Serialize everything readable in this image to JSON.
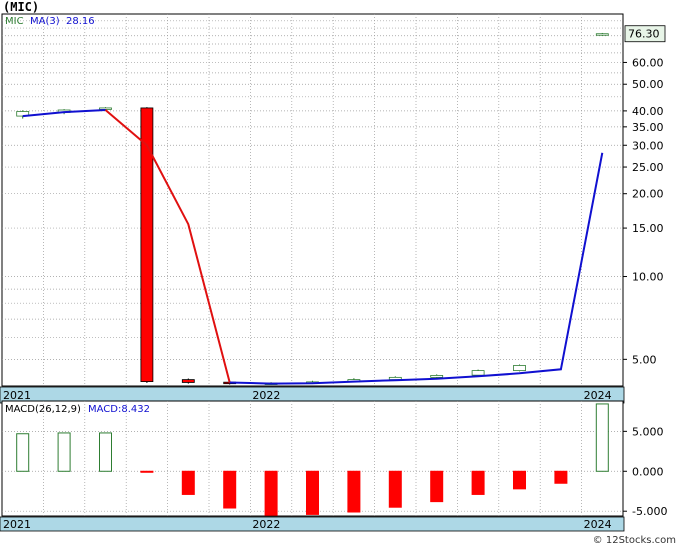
{
  "title": "(MIC)",
  "footer": "© 12Stocks.com",
  "colors": {
    "ma_line": "#1010d0",
    "decline_line": "#e01010",
    "bar_up": "#2e7d32",
    "bar_down": "#ff0000",
    "axis_band": "#add8e6",
    "grid": "#999999",
    "last_price_box": "#e8f5e8"
  },
  "chart_data": [
    {
      "type": "candlestick",
      "legend": {
        "ticker": "MIC",
        "ma_label": "MA(3)",
        "ma_value": "28.16"
      },
      "y_scale": "log",
      "ylim": [
        4.0,
        90.0
      ],
      "y_ticks": [
        {
          "value": 5,
          "label": "5.00"
        },
        {
          "value": 10,
          "label": "10.00"
        },
        {
          "value": 15,
          "label": "15.00"
        },
        {
          "value": 20,
          "label": "20.00"
        },
        {
          "value": 25,
          "label": "25.00"
        },
        {
          "value": 30,
          "label": "30.00"
        },
        {
          "value": 35,
          "label": "35.00"
        },
        {
          "value": 40,
          "label": "40.00"
        },
        {
          "value": 50,
          "label": "50.00"
        },
        {
          "value": 60,
          "label": "60.00"
        }
      ],
      "last_price_label": "76.30",
      "last_price": 76.3,
      "x_labels": [
        {
          "label": "2021",
          "period": 0
        },
        {
          "label": "2022",
          "period": 6
        },
        {
          "label": "2024",
          "period": 14
        }
      ],
      "n_periods": 15,
      "candles": [
        {
          "period": 0,
          "open": 38.3,
          "close": 39.8,
          "high": 40.2,
          "low": 37.5
        },
        {
          "period": 1,
          "open": 39.5,
          "close": 40.3,
          "high": 40.6,
          "low": 38.9
        },
        {
          "period": 2,
          "open": 40.5,
          "close": 41.0,
          "high": 41.3,
          "low": 40.0
        },
        {
          "period": 3,
          "open": 41.0,
          "close": 4.15,
          "high": 41.3,
          "low": 4.1
        },
        {
          "period": 4,
          "open": 4.22,
          "close": 4.12,
          "high": 4.26,
          "low": 4.08
        },
        {
          "period": 5,
          "open": 4.13,
          "close": 4.08,
          "high": 4.17,
          "low": 4.05
        },
        {
          "period": 6,
          "open": 4.08,
          "close": 4.1,
          "high": 4.13,
          "low": 4.05
        },
        {
          "period": 7,
          "open": 4.1,
          "close": 4.14,
          "high": 4.18,
          "low": 4.08
        },
        {
          "period": 8,
          "open": 4.15,
          "close": 4.22,
          "high": 4.27,
          "low": 4.12
        },
        {
          "period": 9,
          "open": 4.22,
          "close": 4.3,
          "high": 4.34,
          "low": 4.2
        },
        {
          "period": 10,
          "open": 4.3,
          "close": 4.37,
          "high": 4.41,
          "low": 4.27
        },
        {
          "period": 11,
          "open": 4.38,
          "close": 4.55,
          "high": 4.59,
          "low": 4.35
        },
        {
          "period": 12,
          "open": 4.55,
          "close": 4.75,
          "high": 4.79,
          "low": 4.52
        },
        {
          "period": 14,
          "open": 75.5,
          "close": 76.3,
          "high": 76.8,
          "low": 75.0
        }
      ],
      "ma_series": [
        {
          "name": "MA(3)",
          "color": "#1010d0",
          "points": [
            [
              0,
              38.3
            ],
            [
              1,
              39.6
            ],
            [
              2,
              40.3
            ]
          ]
        },
        {
          "name": "MA(3)",
          "color": "#e01010",
          "points": [
            [
              2,
              40.3
            ],
            [
              3,
              30.0
            ],
            [
              4,
              15.5
            ],
            [
              5,
              4.12
            ]
          ]
        },
        {
          "name": "MA(3)",
          "color": "#1010d0",
          "points": [
            [
              5,
              4.12
            ],
            [
              6,
              4.08
            ],
            [
              7,
              4.09
            ],
            [
              8,
              4.15
            ],
            [
              9,
              4.2
            ],
            [
              10,
              4.25
            ],
            [
              11,
              4.34
            ],
            [
              12,
              4.45
            ],
            [
              13,
              4.6
            ],
            [
              14,
              28.16
            ]
          ]
        }
      ]
    },
    {
      "type": "bar",
      "legend": {
        "label": "MACD(26,12,9)",
        "value_label": "MACD:8.432"
      },
      "ylim": [
        -5.6,
        8.8
      ],
      "y_ticks": [
        {
          "value": 5,
          "label": "5.000"
        },
        {
          "value": 0,
          "label": "0.000"
        },
        {
          "value": -5,
          "label": "-5.000"
        }
      ],
      "x_labels": [
        {
          "label": "2021",
          "period": 0
        },
        {
          "label": "2022",
          "period": 6
        },
        {
          "label": "2024",
          "period": 14
        }
      ],
      "n_periods": 15,
      "bars": [
        {
          "period": 0,
          "value": 4.7
        },
        {
          "period": 1,
          "value": 4.8
        },
        {
          "period": 2,
          "value": 4.8
        },
        {
          "period": 3,
          "value": -0.1
        },
        {
          "period": 4,
          "value": -2.9
        },
        {
          "period": 5,
          "value": -4.6
        },
        {
          "period": 6,
          "value": -5.5
        },
        {
          "period": 7,
          "value": -5.4
        },
        {
          "period": 8,
          "value": -5.1
        },
        {
          "period": 9,
          "value": -4.5
        },
        {
          "period": 10,
          "value": -3.8
        },
        {
          "period": 11,
          "value": -2.9
        },
        {
          "period": 12,
          "value": -2.2
        },
        {
          "period": 13,
          "value": -1.5
        },
        {
          "period": 14,
          "value": 8.432
        }
      ]
    }
  ]
}
